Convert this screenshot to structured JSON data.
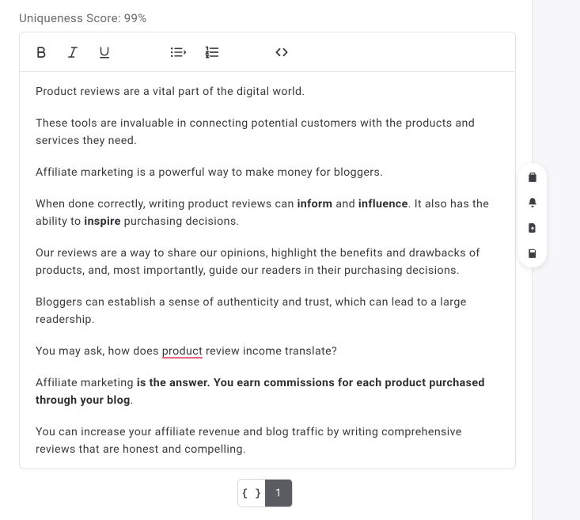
{
  "header": {
    "uniq_label": "Uniqueness Score: 99%"
  },
  "toolbar": {
    "bold": "B",
    "italic": "I",
    "underline": "U",
    "bullet_list": "bullet-list",
    "ordered_list": "ordered-list",
    "code": "code"
  },
  "content": {
    "p1": "Product reviews are a vital part of the digital world.",
    "p2": "These tools are invaluable in connecting potential customers with the products and services they need.",
    "p3": "Affiliate marketing is a powerful way to make money for bloggers.",
    "p4a": "When done correctly, writing product reviews can ",
    "p4b_bold": "inform",
    "p4c": " and ",
    "p4d_bold": "influence",
    "p4e": ". It also has the ability to ",
    "p4f_bold": "inspire",
    "p4g": " purchasing decisions.",
    "p5": "Our reviews are a way to share our opinions, highlight the benefits and drawbacks of products, and, most importantly, guide our readers in their purchasing decisions.",
    "p6": "Bloggers can establish a sense of authenticity and trust, which can lead to a large readership.",
    "p7a": "You may ask, how does ",
    "p7b_err": "product",
    "p7c": " review income translate?",
    "p8a": "Affiliate marketing ",
    "p8b_bold": "is the answer. You earn commissions for each product purchased through your blog",
    "p8c": ".",
    "p9": "You can increase your affiliate revenue and blog traffic by writing comprehensive reviews that are honest and compelling."
  },
  "pager": {
    "braces": "{ }",
    "page1": "1"
  },
  "rail": {
    "clipboard": "clipboard",
    "notify": "notifications",
    "download": "download",
    "save": "save"
  }
}
